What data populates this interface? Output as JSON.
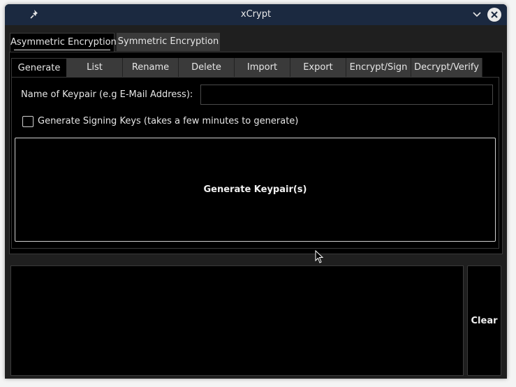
{
  "window": {
    "title": "xCrypt",
    "icons": {
      "pin": "pin-icon",
      "minimize": "chevron-down-icon",
      "close": "close-icon"
    }
  },
  "outer_tabs": [
    {
      "label": "Asymmetric Encryption",
      "active": true
    },
    {
      "label": "Symmetric Encryption",
      "active": false
    }
  ],
  "inner_tabs": [
    {
      "label": "Generate",
      "active": true
    },
    {
      "label": "List"
    },
    {
      "label": "Rename"
    },
    {
      "label": "Delete"
    },
    {
      "label": "Import"
    },
    {
      "label": "Export"
    },
    {
      "label": "Encrypt/Sign"
    },
    {
      "label": "Decrypt/Verify"
    }
  ],
  "generate": {
    "name_label": "Name of Keypair (e.g E-Mail Address):",
    "name_value": "",
    "signing_label": "Generate Signing Keys (takes a few minutes to generate)",
    "signing_checked": false,
    "generate_button": "Generate Keypair(s)"
  },
  "output": {
    "text": ""
  },
  "clear_button": "Clear",
  "colors": {
    "titlebar": "#1b2940",
    "background": "#1f1f1f",
    "panel": "#000000",
    "tab_inactive": "#3a3a3a",
    "text": "#e6e6e6"
  }
}
